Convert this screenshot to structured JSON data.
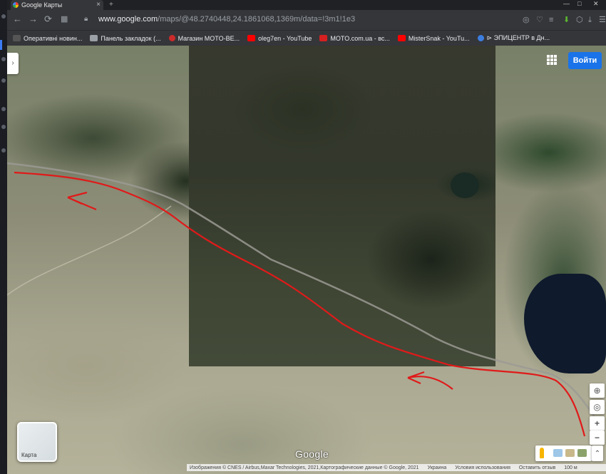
{
  "browser": {
    "tab_title": "Google Карты",
    "new_tab_symbol": "+",
    "url_host": "www.google.com",
    "url_path": "/maps/@48.2740448,24.1861068,1369m/data=!3m1!1e3",
    "controls": {
      "back": "←",
      "forward": "→",
      "reload": "⟳",
      "minimize": "—",
      "maximize": "□",
      "close": "✕"
    }
  },
  "bookmarks": [
    {
      "label": "Оперативні новин...",
      "icon_color": "#555555"
    },
    {
      "label": "Панель закладок (...",
      "icon_color": "#9aa0a6"
    },
    {
      "label": "Магазин MOTO-BE...",
      "icon_color": "#cc2a2a"
    },
    {
      "label": "oleg7en - YouTube",
      "icon_color": "#ff0000"
    },
    {
      "label": "MOTO.com.ua - вс...",
      "icon_color": "#d42020"
    },
    {
      "label": "MisterSnak - YouTu...",
      "icon_color": "#ff0000"
    },
    {
      "label": "⊳ ЭПИЦЕНТР в Дн...",
      "icon_color": "#3c7ee0"
    }
  ],
  "map": {
    "signin_label": "Войти",
    "layer_label": "Карта",
    "google_logo": "Google",
    "zoom_in": "+",
    "zoom_out": "−",
    "attribution": {
      "imagery": "Изображения © CNES / Airbus,Maxar Technologies, 2021,Картографические данные © Google, 2021",
      "country": "Украина",
      "terms": "Условия использования",
      "feedback": "Оставить отзыв",
      "scale": "100 м"
    }
  }
}
